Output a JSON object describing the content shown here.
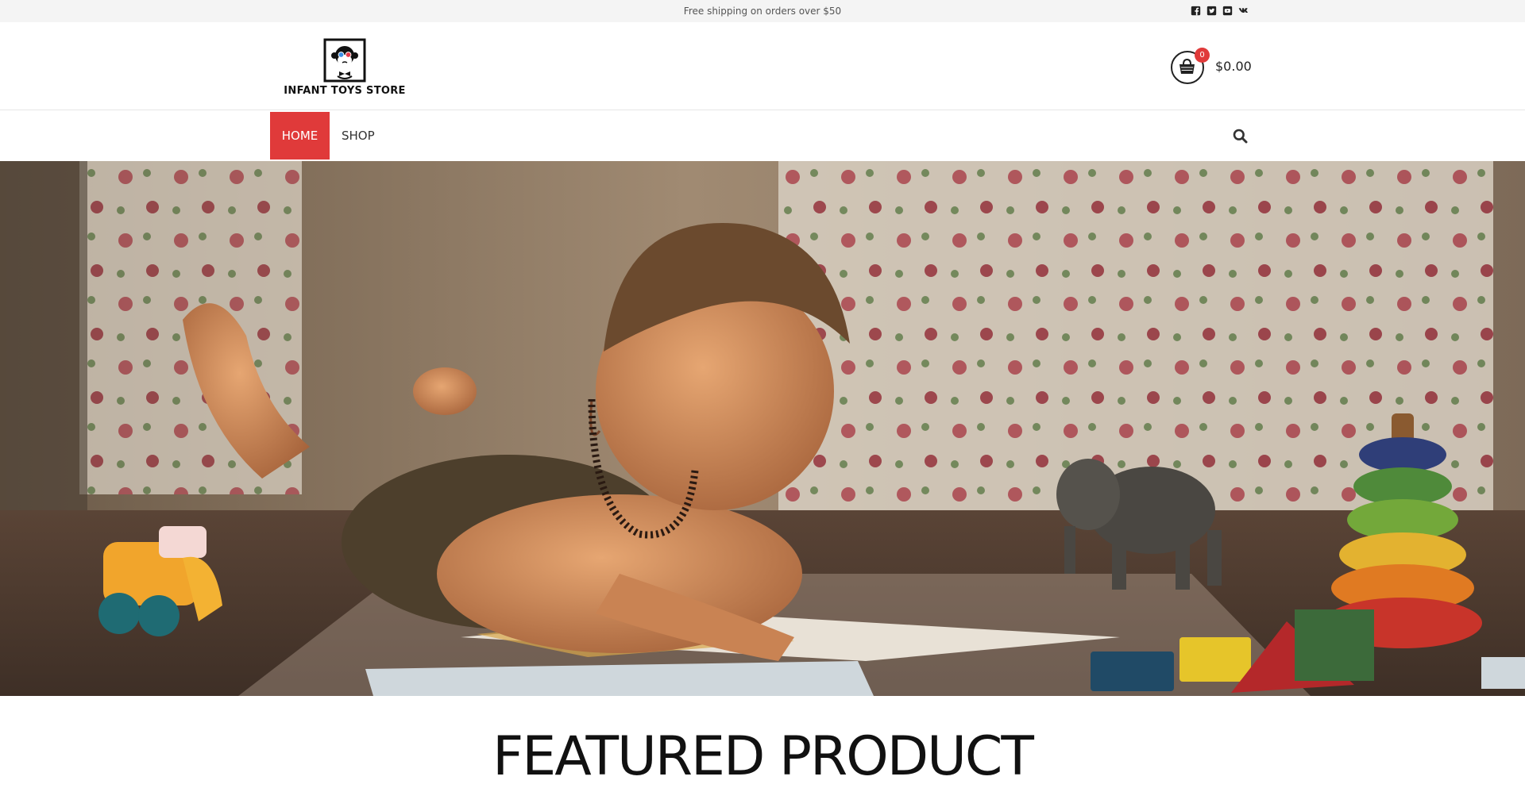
{
  "topbar": {
    "shipping_text": "Free shipping on orders over $50",
    "social": [
      {
        "icon": "facebook-icon"
      },
      {
        "icon": "twitter-icon"
      },
      {
        "icon": "youtube-icon"
      },
      {
        "icon": "vk-icon"
      }
    ]
  },
  "header": {
    "logo_text": "INFANT TOYS STORE",
    "cart": {
      "count": "0",
      "total": "$0.00",
      "icon": "shopping-basket-icon"
    }
  },
  "nav": {
    "items": [
      {
        "label": "HOME",
        "active": true
      },
      {
        "label": "SHOP",
        "active": false
      }
    ],
    "search_icon": "search-icon"
  },
  "hero": {
    "image": "baby lying on floor reading a book with toys"
  },
  "sections": {
    "featured_title": "FEATURED PRODUCT"
  },
  "colors": {
    "accent": "#e03a3a",
    "topbar_bg": "#f4f4f4",
    "text": "#222222"
  }
}
